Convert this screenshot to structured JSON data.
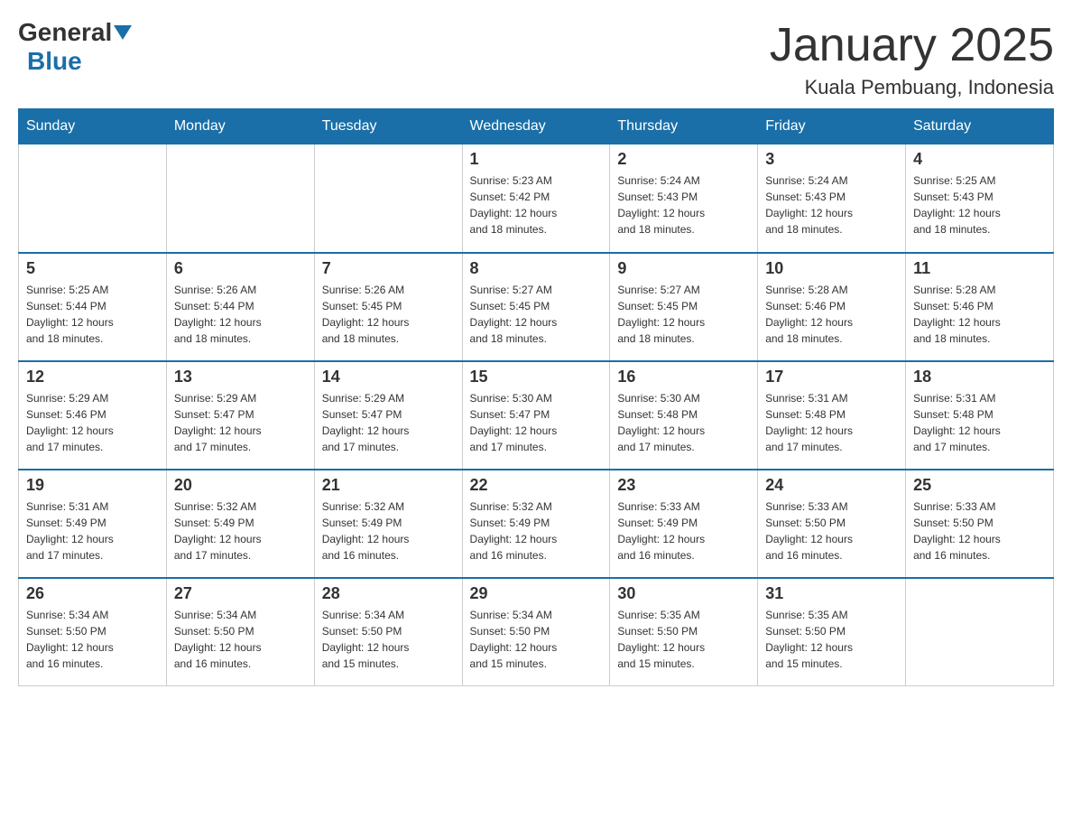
{
  "header": {
    "logo": {
      "general": "General",
      "blue": "Blue"
    },
    "title": "January 2025",
    "location": "Kuala Pembuang, Indonesia"
  },
  "days_of_week": [
    "Sunday",
    "Monday",
    "Tuesday",
    "Wednesday",
    "Thursday",
    "Friday",
    "Saturday"
  ],
  "weeks": [
    [
      {
        "day": "",
        "info": ""
      },
      {
        "day": "",
        "info": ""
      },
      {
        "day": "",
        "info": ""
      },
      {
        "day": "1",
        "info": "Sunrise: 5:23 AM\nSunset: 5:42 PM\nDaylight: 12 hours\nand 18 minutes."
      },
      {
        "day": "2",
        "info": "Sunrise: 5:24 AM\nSunset: 5:43 PM\nDaylight: 12 hours\nand 18 minutes."
      },
      {
        "day": "3",
        "info": "Sunrise: 5:24 AM\nSunset: 5:43 PM\nDaylight: 12 hours\nand 18 minutes."
      },
      {
        "day": "4",
        "info": "Sunrise: 5:25 AM\nSunset: 5:43 PM\nDaylight: 12 hours\nand 18 minutes."
      }
    ],
    [
      {
        "day": "5",
        "info": "Sunrise: 5:25 AM\nSunset: 5:44 PM\nDaylight: 12 hours\nand 18 minutes."
      },
      {
        "day": "6",
        "info": "Sunrise: 5:26 AM\nSunset: 5:44 PM\nDaylight: 12 hours\nand 18 minutes."
      },
      {
        "day": "7",
        "info": "Sunrise: 5:26 AM\nSunset: 5:45 PM\nDaylight: 12 hours\nand 18 minutes."
      },
      {
        "day": "8",
        "info": "Sunrise: 5:27 AM\nSunset: 5:45 PM\nDaylight: 12 hours\nand 18 minutes."
      },
      {
        "day": "9",
        "info": "Sunrise: 5:27 AM\nSunset: 5:45 PM\nDaylight: 12 hours\nand 18 minutes."
      },
      {
        "day": "10",
        "info": "Sunrise: 5:28 AM\nSunset: 5:46 PM\nDaylight: 12 hours\nand 18 minutes."
      },
      {
        "day": "11",
        "info": "Sunrise: 5:28 AM\nSunset: 5:46 PM\nDaylight: 12 hours\nand 18 minutes."
      }
    ],
    [
      {
        "day": "12",
        "info": "Sunrise: 5:29 AM\nSunset: 5:46 PM\nDaylight: 12 hours\nand 17 minutes."
      },
      {
        "day": "13",
        "info": "Sunrise: 5:29 AM\nSunset: 5:47 PM\nDaylight: 12 hours\nand 17 minutes."
      },
      {
        "day": "14",
        "info": "Sunrise: 5:29 AM\nSunset: 5:47 PM\nDaylight: 12 hours\nand 17 minutes."
      },
      {
        "day": "15",
        "info": "Sunrise: 5:30 AM\nSunset: 5:47 PM\nDaylight: 12 hours\nand 17 minutes."
      },
      {
        "day": "16",
        "info": "Sunrise: 5:30 AM\nSunset: 5:48 PM\nDaylight: 12 hours\nand 17 minutes."
      },
      {
        "day": "17",
        "info": "Sunrise: 5:31 AM\nSunset: 5:48 PM\nDaylight: 12 hours\nand 17 minutes."
      },
      {
        "day": "18",
        "info": "Sunrise: 5:31 AM\nSunset: 5:48 PM\nDaylight: 12 hours\nand 17 minutes."
      }
    ],
    [
      {
        "day": "19",
        "info": "Sunrise: 5:31 AM\nSunset: 5:49 PM\nDaylight: 12 hours\nand 17 minutes."
      },
      {
        "day": "20",
        "info": "Sunrise: 5:32 AM\nSunset: 5:49 PM\nDaylight: 12 hours\nand 17 minutes."
      },
      {
        "day": "21",
        "info": "Sunrise: 5:32 AM\nSunset: 5:49 PM\nDaylight: 12 hours\nand 16 minutes."
      },
      {
        "day": "22",
        "info": "Sunrise: 5:32 AM\nSunset: 5:49 PM\nDaylight: 12 hours\nand 16 minutes."
      },
      {
        "day": "23",
        "info": "Sunrise: 5:33 AM\nSunset: 5:49 PM\nDaylight: 12 hours\nand 16 minutes."
      },
      {
        "day": "24",
        "info": "Sunrise: 5:33 AM\nSunset: 5:50 PM\nDaylight: 12 hours\nand 16 minutes."
      },
      {
        "day": "25",
        "info": "Sunrise: 5:33 AM\nSunset: 5:50 PM\nDaylight: 12 hours\nand 16 minutes."
      }
    ],
    [
      {
        "day": "26",
        "info": "Sunrise: 5:34 AM\nSunset: 5:50 PM\nDaylight: 12 hours\nand 16 minutes."
      },
      {
        "day": "27",
        "info": "Sunrise: 5:34 AM\nSunset: 5:50 PM\nDaylight: 12 hours\nand 16 minutes."
      },
      {
        "day": "28",
        "info": "Sunrise: 5:34 AM\nSunset: 5:50 PM\nDaylight: 12 hours\nand 15 minutes."
      },
      {
        "day": "29",
        "info": "Sunrise: 5:34 AM\nSunset: 5:50 PM\nDaylight: 12 hours\nand 15 minutes."
      },
      {
        "day": "30",
        "info": "Sunrise: 5:35 AM\nSunset: 5:50 PM\nDaylight: 12 hours\nand 15 minutes."
      },
      {
        "day": "31",
        "info": "Sunrise: 5:35 AM\nSunset: 5:50 PM\nDaylight: 12 hours\nand 15 minutes."
      },
      {
        "day": "",
        "info": ""
      }
    ]
  ]
}
